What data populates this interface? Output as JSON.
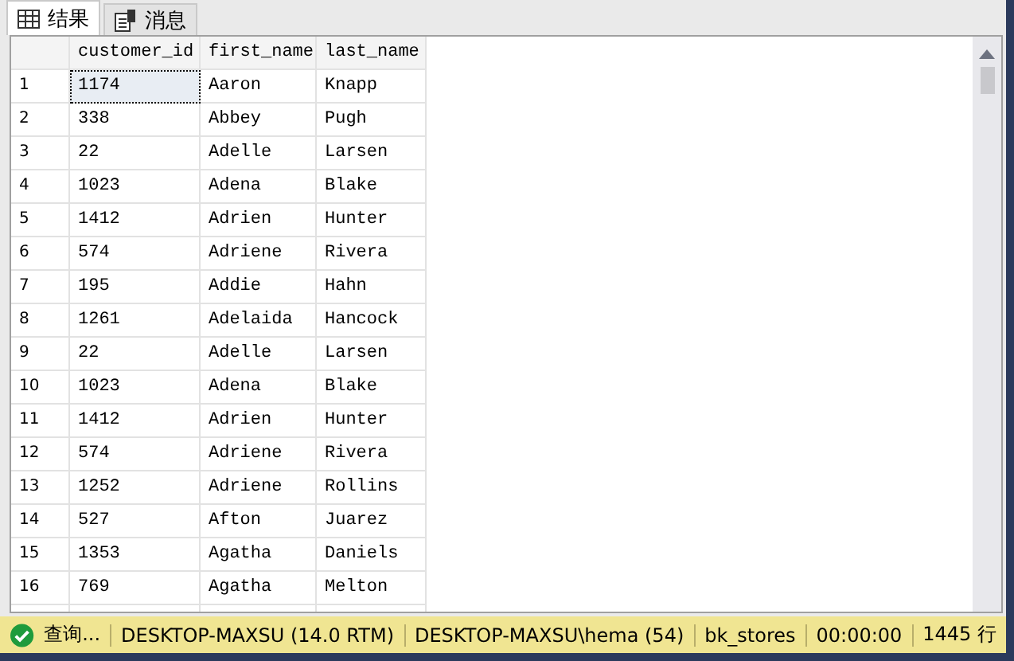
{
  "tabs": [
    {
      "label": "结果",
      "kind": "grid",
      "selected": true
    },
    {
      "label": "消息",
      "kind": "messages",
      "selected": false
    }
  ],
  "table": {
    "columns": [
      "customer_id",
      "first_name",
      "last_name"
    ],
    "rows": [
      {
        "number": "1",
        "cells": [
          "1174",
          "Aaron",
          "Knapp"
        ],
        "selected": true
      },
      {
        "number": "2",
        "cells": [
          "338",
          "Abbey",
          "Pugh"
        ],
        "selected": false
      },
      {
        "number": "3",
        "cells": [
          "22",
          "Adelle",
          "Larsen"
        ],
        "selected": false
      },
      {
        "number": "4",
        "cells": [
          "1023",
          "Adena",
          "Blake"
        ],
        "selected": false
      },
      {
        "number": "5",
        "cells": [
          "1412",
          "Adrien",
          "Hunter"
        ],
        "selected": false
      },
      {
        "number": "6",
        "cells": [
          "574",
          "Adriene",
          "Rivera"
        ],
        "selected": false
      },
      {
        "number": "7",
        "cells": [
          "195",
          "Addie",
          "Hahn"
        ],
        "selected": false
      },
      {
        "number": "8",
        "cells": [
          "1261",
          "Adelaida",
          "Hancock"
        ],
        "selected": false
      },
      {
        "number": "9",
        "cells": [
          "22",
          "Adelle",
          "Larsen"
        ],
        "selected": false
      },
      {
        "number": "10",
        "cells": [
          "1023",
          "Adena",
          "Blake"
        ],
        "selected": false
      },
      {
        "number": "11",
        "cells": [
          "1412",
          "Adrien",
          "Hunter"
        ],
        "selected": false
      },
      {
        "number": "12",
        "cells": [
          "574",
          "Adriene",
          "Rivera"
        ],
        "selected": false
      },
      {
        "number": "13",
        "cells": [
          "1252",
          "Adriene",
          "Rollins"
        ],
        "selected": false
      },
      {
        "number": "14",
        "cells": [
          "527",
          "Afton",
          "Juarez"
        ],
        "selected": false
      },
      {
        "number": "15",
        "cells": [
          "1353",
          "Agatha",
          "Daniels"
        ],
        "selected": false
      },
      {
        "number": "16",
        "cells": [
          "769",
          "Agatha",
          "Melton"
        ],
        "selected": false
      }
    ]
  },
  "status_bar": {
    "status": "查询...",
    "server": "DESKTOP-MAXSU (14.0 RTM)",
    "user": "DESKTOP-MAXSU\\hema (54)",
    "database": "bk_stores",
    "elapsed": "00:00:00",
    "rows": "1445 行"
  }
}
